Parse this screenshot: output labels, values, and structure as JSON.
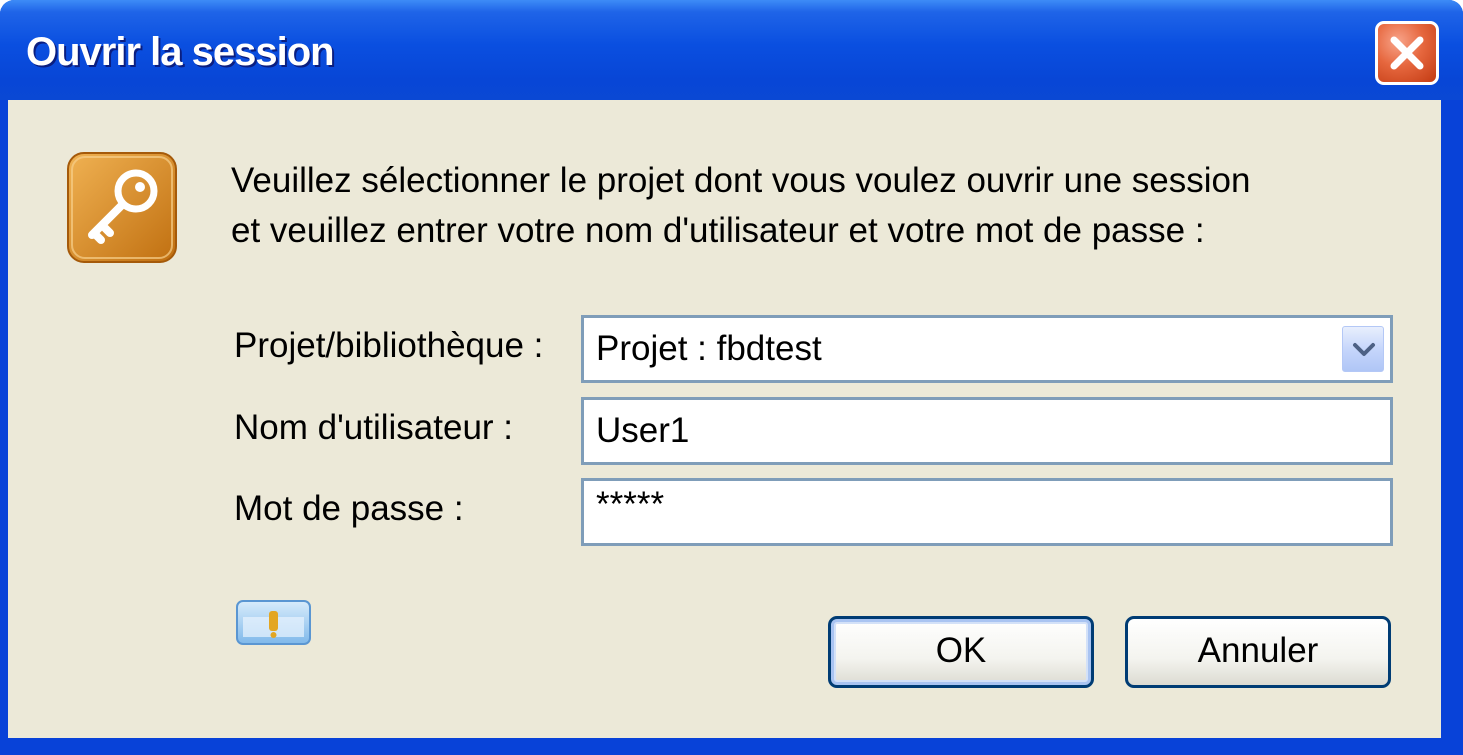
{
  "window": {
    "title": "Ouvrir la session",
    "close_icon": "close-icon"
  },
  "message": {
    "line1": "Veuillez sélectionner le projet dont vous voulez ouvrir une session",
    "line2": "et veuillez entrer votre nom d'utilisateur et votre mot de passe :"
  },
  "form": {
    "project": {
      "label": "Projet/bibliothèque :",
      "value": "Projet : fbdtest"
    },
    "username": {
      "label": "Nom d'utilisateur :",
      "value": "User1"
    },
    "password": {
      "label": "Mot de passe :",
      "value": "*****"
    }
  },
  "buttons": {
    "ok": "OK",
    "cancel": "Annuler"
  },
  "icons": {
    "dialog": "key-icon",
    "help": "help-icon",
    "dropdown": "chevron-down-icon"
  },
  "colors": {
    "titlebar": "#0a4fe0",
    "client": "#ece9d8",
    "close_button": "#e6673e",
    "field_border": "#7f9db9",
    "key_icon": "#d98a1e"
  }
}
